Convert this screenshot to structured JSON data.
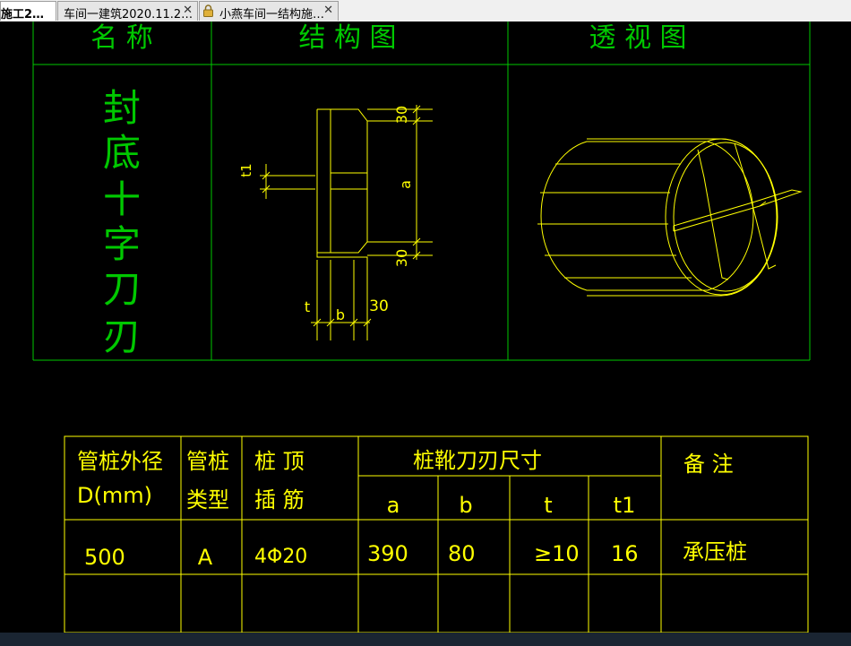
{
  "tabs": [
    {
      "label": "施工2…",
      "closable": false
    },
    {
      "label": "车间一建筑2020.11.2…",
      "closable": true,
      "close": "✕"
    },
    {
      "label": "小燕车间一结构施…",
      "closable": true,
      "close": "✕",
      "icon": "lock-icon"
    }
  ],
  "drawing": {
    "colors": {
      "frame": "#00c800",
      "line": "#ffff00",
      "text": "#00c800"
    },
    "header": {
      "name": "名 称",
      "structure": "结 构 图",
      "perspective": "透 视 图"
    },
    "name_chars": [
      "封",
      "底",
      "十",
      "字",
      "刀",
      "刃"
    ],
    "dims": {
      "top": "30",
      "bottom": "30",
      "a": "a",
      "t1": "t1",
      "t": "t",
      "b": "b",
      "side": "30"
    }
  },
  "spec_table": {
    "headers": {
      "diameter_1": "管桩外径",
      "diameter_2": "D(mm)",
      "type_1": "管桩",
      "type_2": "类型",
      "rebar_1": "桩  顶",
      "rebar_2": "插  筋",
      "blade_group": "桩靴刀刃尺寸",
      "a": "a",
      "b": "b",
      "t": "t",
      "t1": "t1",
      "remark": "备  注"
    },
    "row": {
      "diameter": "500",
      "type": "A",
      "rebar": "4Φ20",
      "a": "390",
      "b": "80",
      "t": "≥10",
      "t1": "16",
      "remark": "承压桩"
    }
  }
}
